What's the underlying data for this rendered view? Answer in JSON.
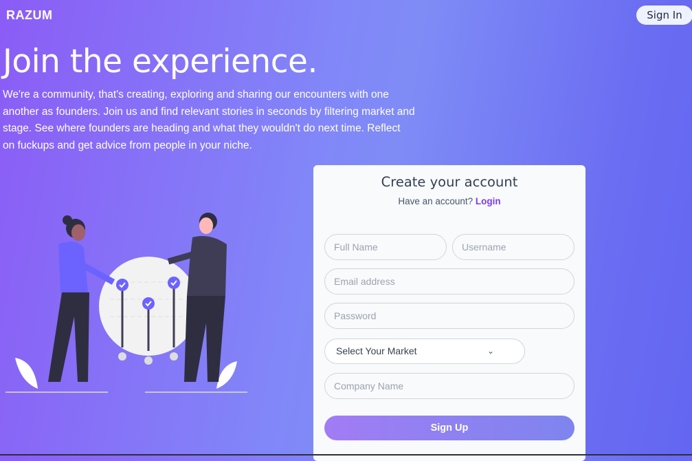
{
  "header": {
    "logo": "RAZUM",
    "sign_in": "Sign In"
  },
  "hero": {
    "title": "Join the experience.",
    "description": "We're a community, that's creating, exploring and sharing our encounters with one another as founders. Join us and find relevant stories in seconds by filtering market and stage. See where founders are heading and what they wouldn't do next time. Reflect on fuckups and get advice from people in your niche."
  },
  "form": {
    "title": "Create your account",
    "have_account": "Have an account?",
    "login": "Login",
    "full_name_placeholder": "Full Name",
    "username_placeholder": "Username",
    "email_placeholder": "Email address",
    "password_placeholder": "Password",
    "market_selected": "Select Your Market",
    "company_placeholder": "Company Name",
    "submit": "Sign Up"
  },
  "colors": {
    "accent": "#7c3aed",
    "gradient_start": "#8b5cf6",
    "gradient_end": "#6366f1"
  }
}
